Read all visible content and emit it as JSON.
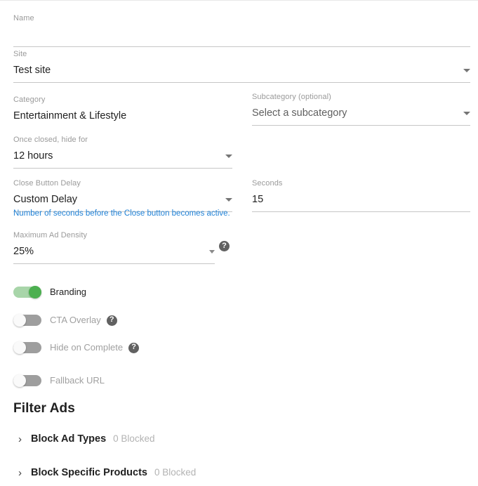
{
  "form": {
    "fields": [
      {
        "key": "name",
        "label": "Name",
        "value": "",
        "type": "text"
      },
      {
        "key": "site",
        "label": "Site",
        "value": "Test site",
        "type": "select"
      },
      {
        "key": "category",
        "label": "Category",
        "value": "Entertainment & Lifestyle",
        "type": "readonly"
      },
      {
        "key": "subcategory",
        "label": "Subcategory (optional)",
        "value": "Select a subcategory",
        "type": "select"
      },
      {
        "key": "hide_for",
        "label": "Once closed, hide for",
        "value": "12 hours",
        "type": "select"
      },
      {
        "key": "close_button_delay",
        "label": "Close Button Delay",
        "value": "Custom Delay",
        "type": "select",
        "helper": "Number of seconds before the Close button becomes active."
      },
      {
        "key": "seconds",
        "label": "Seconds",
        "value": "15",
        "type": "text"
      },
      {
        "key": "max_ad_density",
        "label": "Maximum Ad Density",
        "value": "25%",
        "type": "select",
        "help_icon": "help-circle-icon"
      }
    ]
  },
  "toggles": [
    {
      "key": "branding",
      "label": "Branding",
      "on": true,
      "help_icon": null
    },
    {
      "key": "cta_overlay",
      "label": "CTA Overlay",
      "on": false,
      "help_icon": "help-circle-icon"
    },
    {
      "key": "hide_on_complete",
      "label": "Hide on Complete",
      "on": false,
      "help_icon": "help-circle-icon"
    },
    {
      "key": "fallback_url",
      "label": "Fallback URL",
      "on": false,
      "help_icon": null
    }
  ],
  "filter_ads": {
    "title": "Filter Ads",
    "rows": [
      {
        "key": "block_ad_types",
        "chevron": "›",
        "title": "Block Ad Types",
        "count": "0 Blocked"
      },
      {
        "key": "block_specific_products",
        "chevron": "›",
        "title": "Block Specific Products",
        "count": "0 Blocked"
      }
    ]
  },
  "icons": {
    "help": "?",
    "caret_down": "caret-down-icon"
  },
  "colors": {
    "toggle_on_track": "#a8d5a9",
    "toggle_on_thumb": "#4caf50",
    "toggle_off_track": "#9e9e9e",
    "helper_text": "#1f81d6",
    "label": "#9a9a9a",
    "text": "#212121",
    "muted": "#a0a0a0",
    "underline": "#c6c6c6"
  }
}
